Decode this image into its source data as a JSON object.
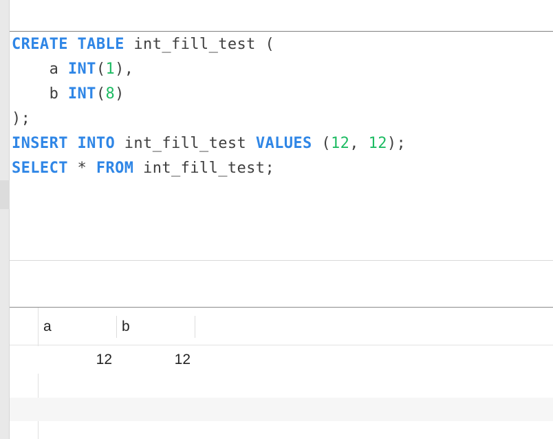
{
  "editor": {
    "lines": [
      {
        "tokens": [
          {
            "t": "CREATE",
            "k": "kw"
          },
          {
            "t": " ",
            "k": "plain"
          },
          {
            "t": "TABLE",
            "k": "kw"
          },
          {
            "t": " int_fill_test (",
            "k": "plain"
          }
        ]
      },
      {
        "tokens": [
          {
            "t": "    a ",
            "k": "plain"
          },
          {
            "t": "INT",
            "k": "kw"
          },
          {
            "t": "(",
            "k": "plain"
          },
          {
            "t": "1",
            "k": "num"
          },
          {
            "t": "),",
            "k": "plain"
          }
        ]
      },
      {
        "tokens": [
          {
            "t": "    b ",
            "k": "plain"
          },
          {
            "t": "INT",
            "k": "kw"
          },
          {
            "t": "(",
            "k": "plain"
          },
          {
            "t": "8",
            "k": "num"
          },
          {
            "t": ")",
            "k": "plain"
          }
        ]
      },
      {
        "tokens": [
          {
            "t": ");",
            "k": "plain"
          }
        ]
      },
      {
        "tokens": [
          {
            "t": "INSERT",
            "k": "kw"
          },
          {
            "t": " ",
            "k": "plain"
          },
          {
            "t": "INTO",
            "k": "kw"
          },
          {
            "t": " int_fill_test ",
            "k": "plain"
          },
          {
            "t": "VALUES",
            "k": "kw"
          },
          {
            "t": " (",
            "k": "plain"
          },
          {
            "t": "12",
            "k": "num"
          },
          {
            "t": ", ",
            "k": "plain"
          },
          {
            "t": "12",
            "k": "num"
          },
          {
            "t": ");",
            "k": "plain"
          }
        ]
      },
      {
        "tokens": [
          {
            "t": "SELECT",
            "k": "kw"
          },
          {
            "t": " * ",
            "k": "plain"
          },
          {
            "t": "FROM",
            "k": "kw"
          },
          {
            "t": " int_fill_test;",
            "k": "plain"
          }
        ]
      }
    ]
  },
  "colors": {
    "keyword": "#2f86e6",
    "number": "#1dbb62",
    "text": "#3f3f3f"
  },
  "results": {
    "columns": [
      "a",
      "b"
    ],
    "rows": [
      [
        "12",
        "12"
      ]
    ]
  }
}
